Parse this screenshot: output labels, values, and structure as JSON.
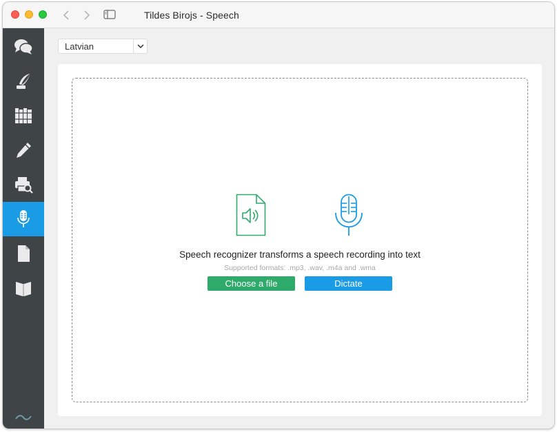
{
  "window": {
    "title": "Tildes Birojs - Speech"
  },
  "sidebar": {
    "items": [
      {
        "icon": "chat-bubbles-icon",
        "active": false
      },
      {
        "icon": "quill-pen-icon",
        "active": false
      },
      {
        "icon": "books-icon",
        "active": false
      },
      {
        "icon": "pencil-icon",
        "active": false
      },
      {
        "icon": "printer-search-icon",
        "active": false
      },
      {
        "icon": "microphone-icon",
        "active": true
      },
      {
        "icon": "document-icon",
        "active": false
      },
      {
        "icon": "open-book-icon",
        "active": false
      }
    ],
    "footer_icon": "tilde-wave-icon"
  },
  "language_select": {
    "value": "Latvian"
  },
  "speech": {
    "headline": "Speech recognizer transforms a speech recording into text",
    "formats": "Supported formats: .mp3, .wav, .m4a and .wma",
    "choose_file_label": "Choose a file",
    "dictate_label": "Dictate"
  },
  "colors": {
    "sidebar_bg": "#3f4447",
    "accent_blue": "#1a9be6",
    "accent_green": "#2eaa6b"
  }
}
